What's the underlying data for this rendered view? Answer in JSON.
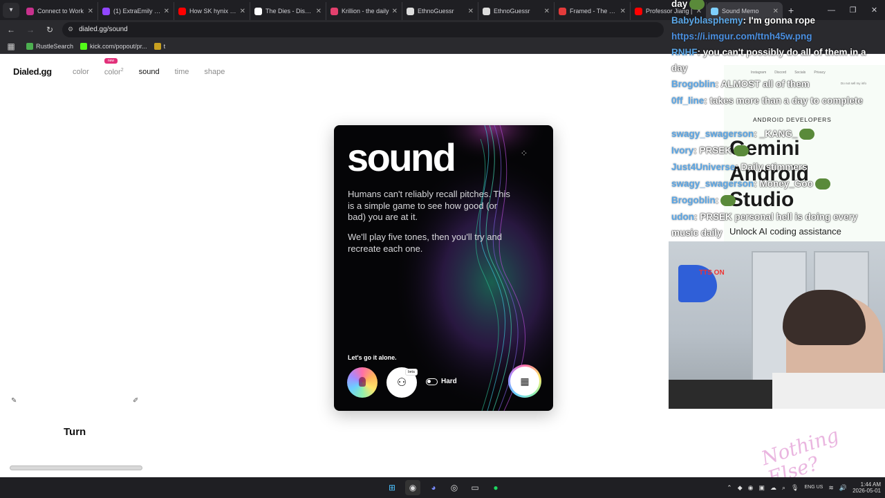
{
  "browser": {
    "tabs": [
      {
        "label": "Connect to Work",
        "color": "#c8318d",
        "active": false
      },
      {
        "label": "(1) ExtraEmily - Tw",
        "color": "#9146ff",
        "active": false
      },
      {
        "label": "How SK hynix Wo",
        "color": "#ff0000",
        "active": false
      },
      {
        "label": "The Dies - Discov",
        "color": "#ffffff",
        "active": false
      },
      {
        "label": "Krillion - the daily",
        "color": "#e3406d",
        "active": false
      },
      {
        "label": "EthnoGuessr",
        "color": "#dddddd",
        "active": false
      },
      {
        "label": "EthnoGuessr",
        "color": "#dddddd",
        "active": false
      },
      {
        "label": "Framed - The dail",
        "color": "#e33b3b",
        "active": false
      },
      {
        "label": "Professor Jiang |",
        "color": "#ff0000",
        "active": false
      },
      {
        "label": "Sound Memo",
        "color": "#7fd0ff",
        "active": true
      }
    ],
    "new_tab": "+",
    "url": "dialed.gg/sound",
    "bookmarks": [
      {
        "label": "RustleSearch",
        "color": "#4caf50"
      },
      {
        "label": "kick.com/popout/pr...",
        "color": "#53fc18"
      },
      {
        "label": "t",
        "color": "#c8a020"
      }
    ]
  },
  "site": {
    "logo": "Dialed.gg",
    "nav": [
      {
        "label": "color",
        "active": false
      },
      {
        "label": "color",
        "sup": "2",
        "badge": "new",
        "active": false
      },
      {
        "label": "sound",
        "active": true
      },
      {
        "label": "time",
        "active": false
      },
      {
        "label": "shape",
        "active": false
      }
    ]
  },
  "card": {
    "title": "sound",
    "para1": "Humans can't reliably recall pitches. This is a simple game to see how good (or bad) you are at it.",
    "para2": "We'll play five tones, then you'll try and recreate each one.",
    "solo_label": "Let's go it alone.",
    "beta_badge": "beta",
    "hard_label": "Hard"
  },
  "page_misc": {
    "turn_label": "Turn"
  },
  "ad": {
    "links": [
      "Instagram",
      "Discord",
      "Socials",
      "Privacy"
    ],
    "do_not_sell": "Do not sell my info",
    "header": "ANDROID DEVELOPERS",
    "headline": [
      "Gemini",
      "Android",
      "Studio"
    ],
    "cta": "Unlock AI coding assistance"
  },
  "chat": [
    {
      "user": "",
      "text": "day"
    },
    {
      "user": "Babyblasphemy",
      "text": ": I'm gonna rope"
    },
    {
      "user": "",
      "text": "https://i.imgur.com/ttnh45w.png",
      "is_link": true
    },
    {
      "user": "RNHF",
      "text": ": you can't possibly do all of them in a"
    },
    {
      "user": "",
      "text": "day"
    },
    {
      "user": "Brogoblin",
      "text": ": ALMOST all of them"
    },
    {
      "user": "0ff_line",
      "text": ": takes more than a day to complete"
    },
    {
      "user": "",
      "text": ""
    },
    {
      "user": "swagy_swagerson",
      "text": ": _KANG_"
    },
    {
      "user": "Ivory",
      "text": ": PRSEK"
    },
    {
      "user": "Just4Universe",
      "text": ": Daily stimmers"
    },
    {
      "user": "swagy_swagerson",
      "text": ": Money_Goo"
    },
    {
      "user": "Brogoblin",
      "text": ":"
    },
    {
      "user": "udon",
      "text": ": PRSEK personal hell is doing every"
    },
    {
      "user": "",
      "text": "music daily"
    }
  ],
  "overlay": {
    "tts_label": "TTS ON",
    "watermark": "Nothing Else?"
  },
  "taskbar": {
    "lang": "ENG US",
    "time": "1:44 AM",
    "date": "2026-05-01"
  }
}
